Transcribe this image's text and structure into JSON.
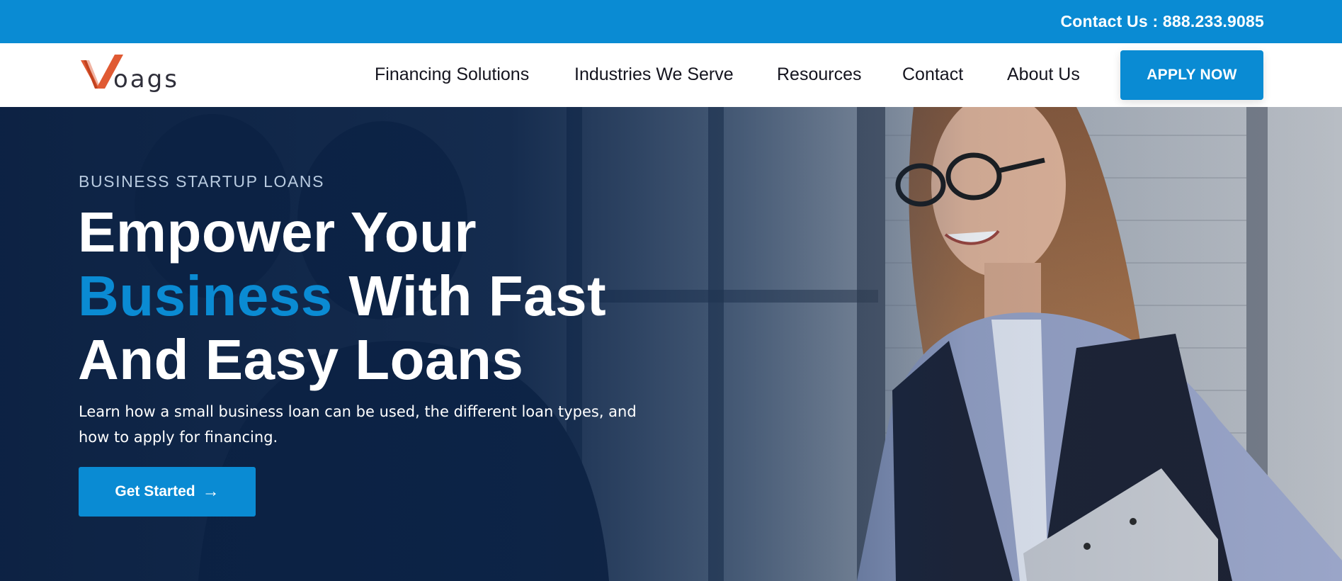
{
  "topbar": {
    "contact": "Contact Us : 888.233.9085"
  },
  "brand": {
    "logo_text": "oags",
    "logo_letter": "V",
    "logo_color": "#e05a33"
  },
  "nav": {
    "items": [
      {
        "label": "Financing Solutions"
      },
      {
        "label": "Industries We Serve"
      },
      {
        "label": "Resources"
      },
      {
        "label": "Contact"
      },
      {
        "label": "About Us"
      }
    ],
    "apply_label": "APPLY NOW"
  },
  "hero": {
    "eyebrow": "BUSINESS STARTUP LOANS",
    "headline_line1": "Empower Your",
    "headline_accent": "Business",
    "headline_line2_rest": "With Fast",
    "headline_line3": "And Easy Loans",
    "subtext": "Learn how a small business loan can be used, the different loan types, and how to apply for financing.",
    "cta_label": "Get Started",
    "cta_icon": "arrow-right-icon"
  },
  "colors": {
    "accent": "#0a8bd3",
    "hero_overlay": "#0c2448",
    "text_dark": "#14141e"
  }
}
